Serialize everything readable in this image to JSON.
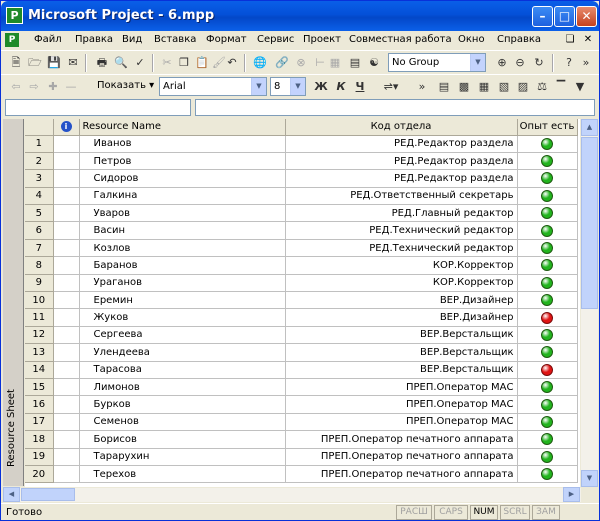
{
  "window": {
    "title": "Microsoft Project - 6.mpp",
    "app_icon_letter": "P"
  },
  "menu": {
    "items": [
      "Файл",
      "Правка",
      "Вид",
      "Вставка",
      "Формат",
      "Сервис",
      "Проект",
      "Совместная работа",
      "Окно",
      "Справка"
    ]
  },
  "toolbar1": {
    "group_combo": "No Group"
  },
  "toolbar2": {
    "show_label": "Показать",
    "font_combo": "Arial",
    "size_combo": "8",
    "bold": "Ж",
    "italic": "К",
    "underline": "Ч"
  },
  "view_bar": {
    "label": "Resource Sheet"
  },
  "table": {
    "columns": [
      "Resource Name",
      "Код отдела",
      "Опыт есть"
    ],
    "rows": [
      {
        "id": "1",
        "name": "Иванов",
        "code": "РЕД.Редактор раздела",
        "status": "green"
      },
      {
        "id": "2",
        "name": "Петров",
        "code": "РЕД.Редактор раздела",
        "status": "green"
      },
      {
        "id": "3",
        "name": "Сидоров",
        "code": "РЕД.Редактор раздела",
        "status": "green"
      },
      {
        "id": "4",
        "name": "Галкина",
        "code": "РЕД.Ответственный секретарь",
        "status": "green"
      },
      {
        "id": "5",
        "name": "Уваров",
        "code": "РЕД.Главный редактор",
        "status": "green"
      },
      {
        "id": "6",
        "name": "Васин",
        "code": "РЕД.Технический редактор",
        "status": "green"
      },
      {
        "id": "7",
        "name": "Козлов",
        "code": "РЕД.Технический редактор",
        "status": "green"
      },
      {
        "id": "8",
        "name": "Баранов",
        "code": "КОР.Корректор",
        "status": "green"
      },
      {
        "id": "9",
        "name": "Ураганов",
        "code": "КОР.Корректор",
        "status": "green"
      },
      {
        "id": "10",
        "name": "Еремин",
        "code": "ВЕР.Дизайнер",
        "status": "green"
      },
      {
        "id": "11",
        "name": "Жуков",
        "code": "ВЕР.Дизайнер",
        "status": "red"
      },
      {
        "id": "12",
        "name": "Сергеева",
        "code": "ВЕР.Верстальщик",
        "status": "green"
      },
      {
        "id": "13",
        "name": "Улендеева",
        "code": "ВЕР.Верстальщик",
        "status": "green"
      },
      {
        "id": "14",
        "name": "Тарасова",
        "code": "ВЕР.Верстальщик",
        "status": "red"
      },
      {
        "id": "15",
        "name": "Лимонов",
        "code": "ПРЕП.Оператор МАС",
        "status": "green"
      },
      {
        "id": "16",
        "name": "Бурков",
        "code": "ПРЕП.Оператор МАС",
        "status": "green"
      },
      {
        "id": "17",
        "name": "Семенов",
        "code": "ПРЕП.Оператор МАС",
        "status": "green"
      },
      {
        "id": "18",
        "name": "Борисов",
        "code": "ПРЕП.Оператор печатного аппарата",
        "status": "green"
      },
      {
        "id": "19",
        "name": "Тарарухин",
        "code": "ПРЕП.Оператор печатного аппарата",
        "status": "green"
      },
      {
        "id": "20",
        "name": "Терехов",
        "code": "ПРЕП.Оператор печатного аппарата",
        "status": "green"
      }
    ]
  },
  "colors": {
    "green": "#22B41E",
    "red": "#E01414"
  },
  "status": {
    "text": "Готово",
    "indicators": [
      {
        "label": "РАСШ",
        "on": false
      },
      {
        "label": "CAPS",
        "on": false
      },
      {
        "label": "NUM",
        "on": true
      },
      {
        "label": "SCRL",
        "on": false
      },
      {
        "label": "ЗАМ",
        "on": false
      }
    ]
  }
}
